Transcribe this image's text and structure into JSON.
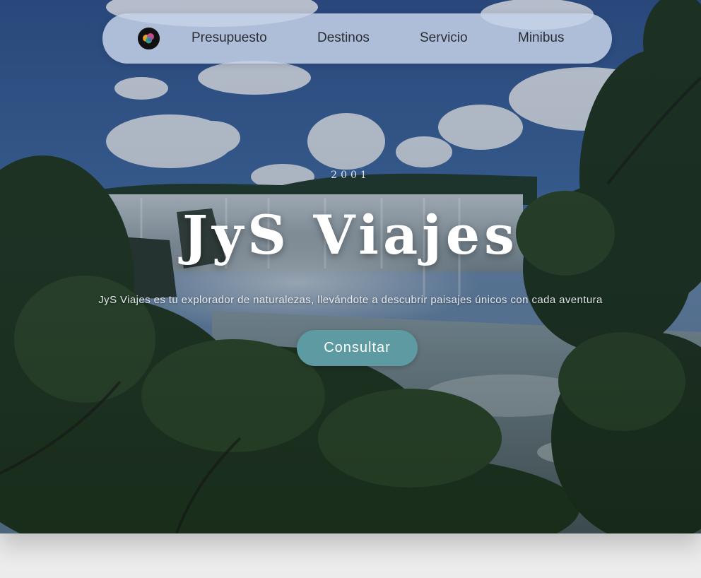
{
  "nav": {
    "logo_icon": "jys-logo",
    "links": [
      "Presupuesto",
      "Destinos",
      "Servicio",
      "Minibus"
    ]
  },
  "hero": {
    "year": "2001",
    "title": "JyS Viajes",
    "subtitle": "JyS Viajes es tu explorador de naturalezas, llevándote a descubrir paisajes únicos con cada aventura",
    "cta_label": "Consultar",
    "background_image": "iguazu-waterfalls-photo"
  },
  "colors": {
    "navbar_bg": "#c4d2e8",
    "nav_text": "#2a2d33",
    "cta_bg": "#5e9aa2",
    "page_bg": "#ececec"
  }
}
